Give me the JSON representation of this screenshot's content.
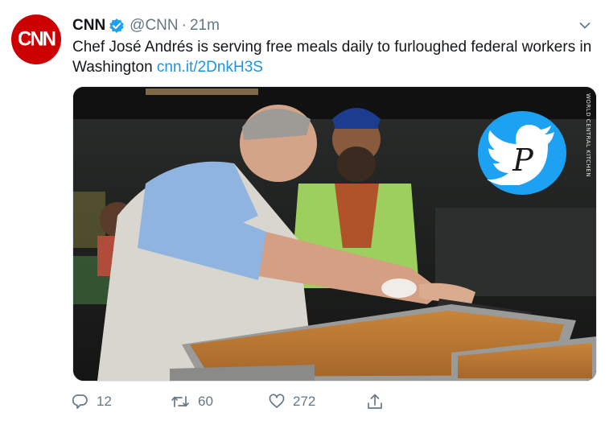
{
  "tweet": {
    "avatar_text": "CNN",
    "display_name": "CNN",
    "handle": "@CNN",
    "separator": "·",
    "time": "21m",
    "text": "Chef José Andrés is serving free meals daily to furloughed federal workers in Washington",
    "link": "cnn.it/2DnkH3S",
    "media_credit": "WORLD CENTRAL KITCHEN",
    "watermark_letter": "P"
  },
  "actions": {
    "replies": "12",
    "retweets": "60",
    "likes": "272"
  },
  "colors": {
    "brand_red": "#cc0000",
    "twitter_blue": "#1da1f2",
    "link": "#1b95e0",
    "muted": "#657786"
  },
  "icons": [
    "verified-icon",
    "caret-down-icon",
    "reply-icon",
    "retweet-icon",
    "like-icon",
    "share-icon",
    "twitter-bird-icon"
  ]
}
